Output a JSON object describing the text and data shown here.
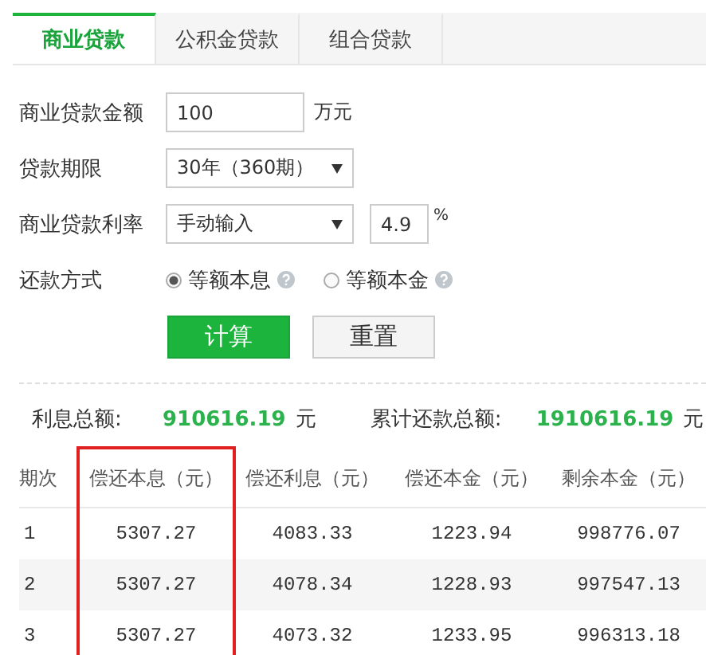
{
  "tabs": [
    {
      "label": "商业贷款",
      "selected": true
    },
    {
      "label": "公积金贷款",
      "selected": false
    },
    {
      "label": "组合贷款",
      "selected": false
    }
  ],
  "form": {
    "amount": {
      "label": "商业贷款金额",
      "value": "100",
      "unit": "万元"
    },
    "term": {
      "label": "贷款期限",
      "value": "30年（360期）"
    },
    "rate": {
      "label": "商业贷款利率",
      "mode": "手动输入",
      "value": "4.9",
      "unit": "%"
    },
    "repayment": {
      "label": "还款方式",
      "options": [
        {
          "label": "等额本息",
          "selected": true
        },
        {
          "label": "等额本金",
          "selected": false
        }
      ]
    }
  },
  "buttons": [
    {
      "label": "计算",
      "kind": "primary"
    },
    {
      "label": "重置",
      "kind": "secondary"
    }
  ],
  "summary": [
    {
      "label": "利息总额:",
      "value": "910616.19",
      "unit": "元"
    },
    {
      "label": "累计还款总额:",
      "value": "1910616.19",
      "unit": "元"
    }
  ],
  "table": {
    "columns": [
      {
        "label": "期次",
        "highlighted": false
      },
      {
        "label": "偿还本息（元）",
        "highlighted": true
      },
      {
        "label": "偿还利息（元）",
        "highlighted": false
      },
      {
        "label": "偿还本金（元）",
        "highlighted": false
      },
      {
        "label": "剩余本金（元）",
        "highlighted": false
      }
    ],
    "rows": [
      [
        "1",
        "5307.27",
        "4083.33",
        "1223.94",
        "998776.07"
      ],
      [
        "2",
        "5307.27",
        "4078.34",
        "1228.93",
        "997547.13"
      ],
      [
        "3",
        "5307.27",
        "4073.32",
        "1233.95",
        "996313.18"
      ]
    ]
  }
}
